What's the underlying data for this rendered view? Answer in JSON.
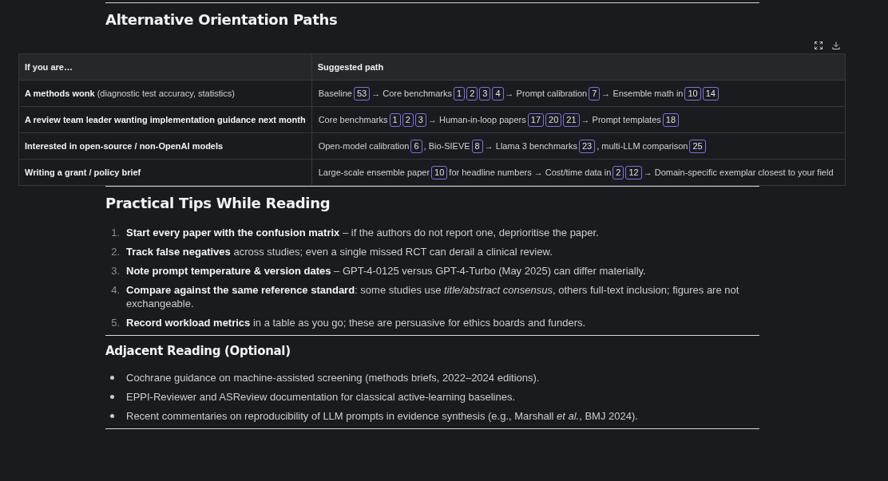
{
  "sections": [
    {
      "kind": "table",
      "title": "Alternative Orientation Paths",
      "columns": [
        "If you are…",
        "Suggested path"
      ],
      "rows": [
        {
          "who": "A methods wonk",
          "note": "(diagnostic test accuracy, statistics)",
          "path": [
            {
              "kind": "text",
              "text": "Baseline"
            },
            {
              "kind": "cite",
              "text": "53"
            },
            {
              "kind": "text",
              "text": "→ Core benchmarks"
            },
            {
              "kind": "cite",
              "text": "1"
            },
            {
              "kind": "cite",
              "text": "2"
            },
            {
              "kind": "cite",
              "text": "3"
            },
            {
              "kind": "cite",
              "text": "4"
            },
            {
              "kind": "text",
              "text": "→ Prompt calibration"
            },
            {
              "kind": "cite",
              "text": "7"
            },
            {
              "kind": "text",
              "text": "→ Ensemble math in"
            },
            {
              "kind": "cite",
              "text": "10"
            },
            {
              "kind": "cite",
              "text": "14"
            }
          ]
        },
        {
          "who": "A review team leader wanting implementation guidance next month",
          "path": [
            {
              "kind": "text",
              "text": "Core benchmarks"
            },
            {
              "kind": "cite",
              "text": "1"
            },
            {
              "kind": "cite",
              "text": "2"
            },
            {
              "kind": "cite",
              "text": "3"
            },
            {
              "kind": "text",
              "text": "→ Human-in-loop papers"
            },
            {
              "kind": "cite",
              "text": "17"
            },
            {
              "kind": "cite",
              "text": "20"
            },
            {
              "kind": "cite",
              "text": "21"
            },
            {
              "kind": "text",
              "text": "→ Prompt templates"
            },
            {
              "kind": "cite",
              "text": "18"
            }
          ]
        },
        {
          "who": "Interested in open-source / non-OpenAI models",
          "path": [
            {
              "kind": "text",
              "text": "Open-model calibration"
            },
            {
              "kind": "cite",
              "text": "6"
            },
            {
              "kind": "text",
              "text": ", Bio-SIEVE"
            },
            {
              "kind": "cite",
              "text": "8"
            },
            {
              "kind": "text",
              "text": "→ Llama 3 benchmarks"
            },
            {
              "kind": "cite",
              "text": "23"
            },
            {
              "kind": "text",
              "text": ", multi-LLM comparison"
            },
            {
              "kind": "cite",
              "text": "25"
            }
          ]
        },
        {
          "who": "Writing a grant / policy brief",
          "path": [
            {
              "kind": "text",
              "text": "Large-scale ensemble paper"
            },
            {
              "kind": "cite",
              "text": "10"
            },
            {
              "kind": "text",
              "text": "for headline numbers → Cost/time data in"
            },
            {
              "kind": "cite",
              "text": "2"
            },
            {
              "kind": "cite",
              "text": "12"
            },
            {
              "kind": "text",
              "text": "→ Domain-specific exemplar closest to your field"
            }
          ]
        }
      ]
    },
    {
      "kind": "ordered",
      "title": "Practical Tips While Reading",
      "items": [
        {
          "number": "1.",
          "text": "**Start every paper with the confusion matrix** – if the authors do not report one, deprioritise the paper."
        },
        {
          "number": "2.",
          "text": "**Track false negatives** across studies; even a single missed RCT can derail a clinical review."
        },
        {
          "number": "3.",
          "text": "**Note prompt temperature & version dates** – GPT-4-0125 versus GPT-4-Turbo (May 2025) can differ materially."
        },
        {
          "number": "4.",
          "text": "**Compare against the same reference standard**: some studies use *title/abstract consensus*, others full-text inclusion; figures are not exchangeable."
        },
        {
          "number": "5.",
          "text": "**Record workload metrics** in a table as you go; these are persuasive for ethics boards and funders."
        }
      ]
    },
    {
      "kind": "bullets",
      "title": "Adjacent Reading (Optional)",
      "items": [
        "Cochrane guidance on machine-assisted screening (methods briefs, 2022–2024 editions).",
        "EPPI-Reviewer and ASReview documentation for classical active-learning baselines.",
        "Recent commentaries on reproducibility of LLM prompts in evidence synthesis (e.g., Marshall *et al.*, BMJ 2024)."
      ]
    }
  ]
}
